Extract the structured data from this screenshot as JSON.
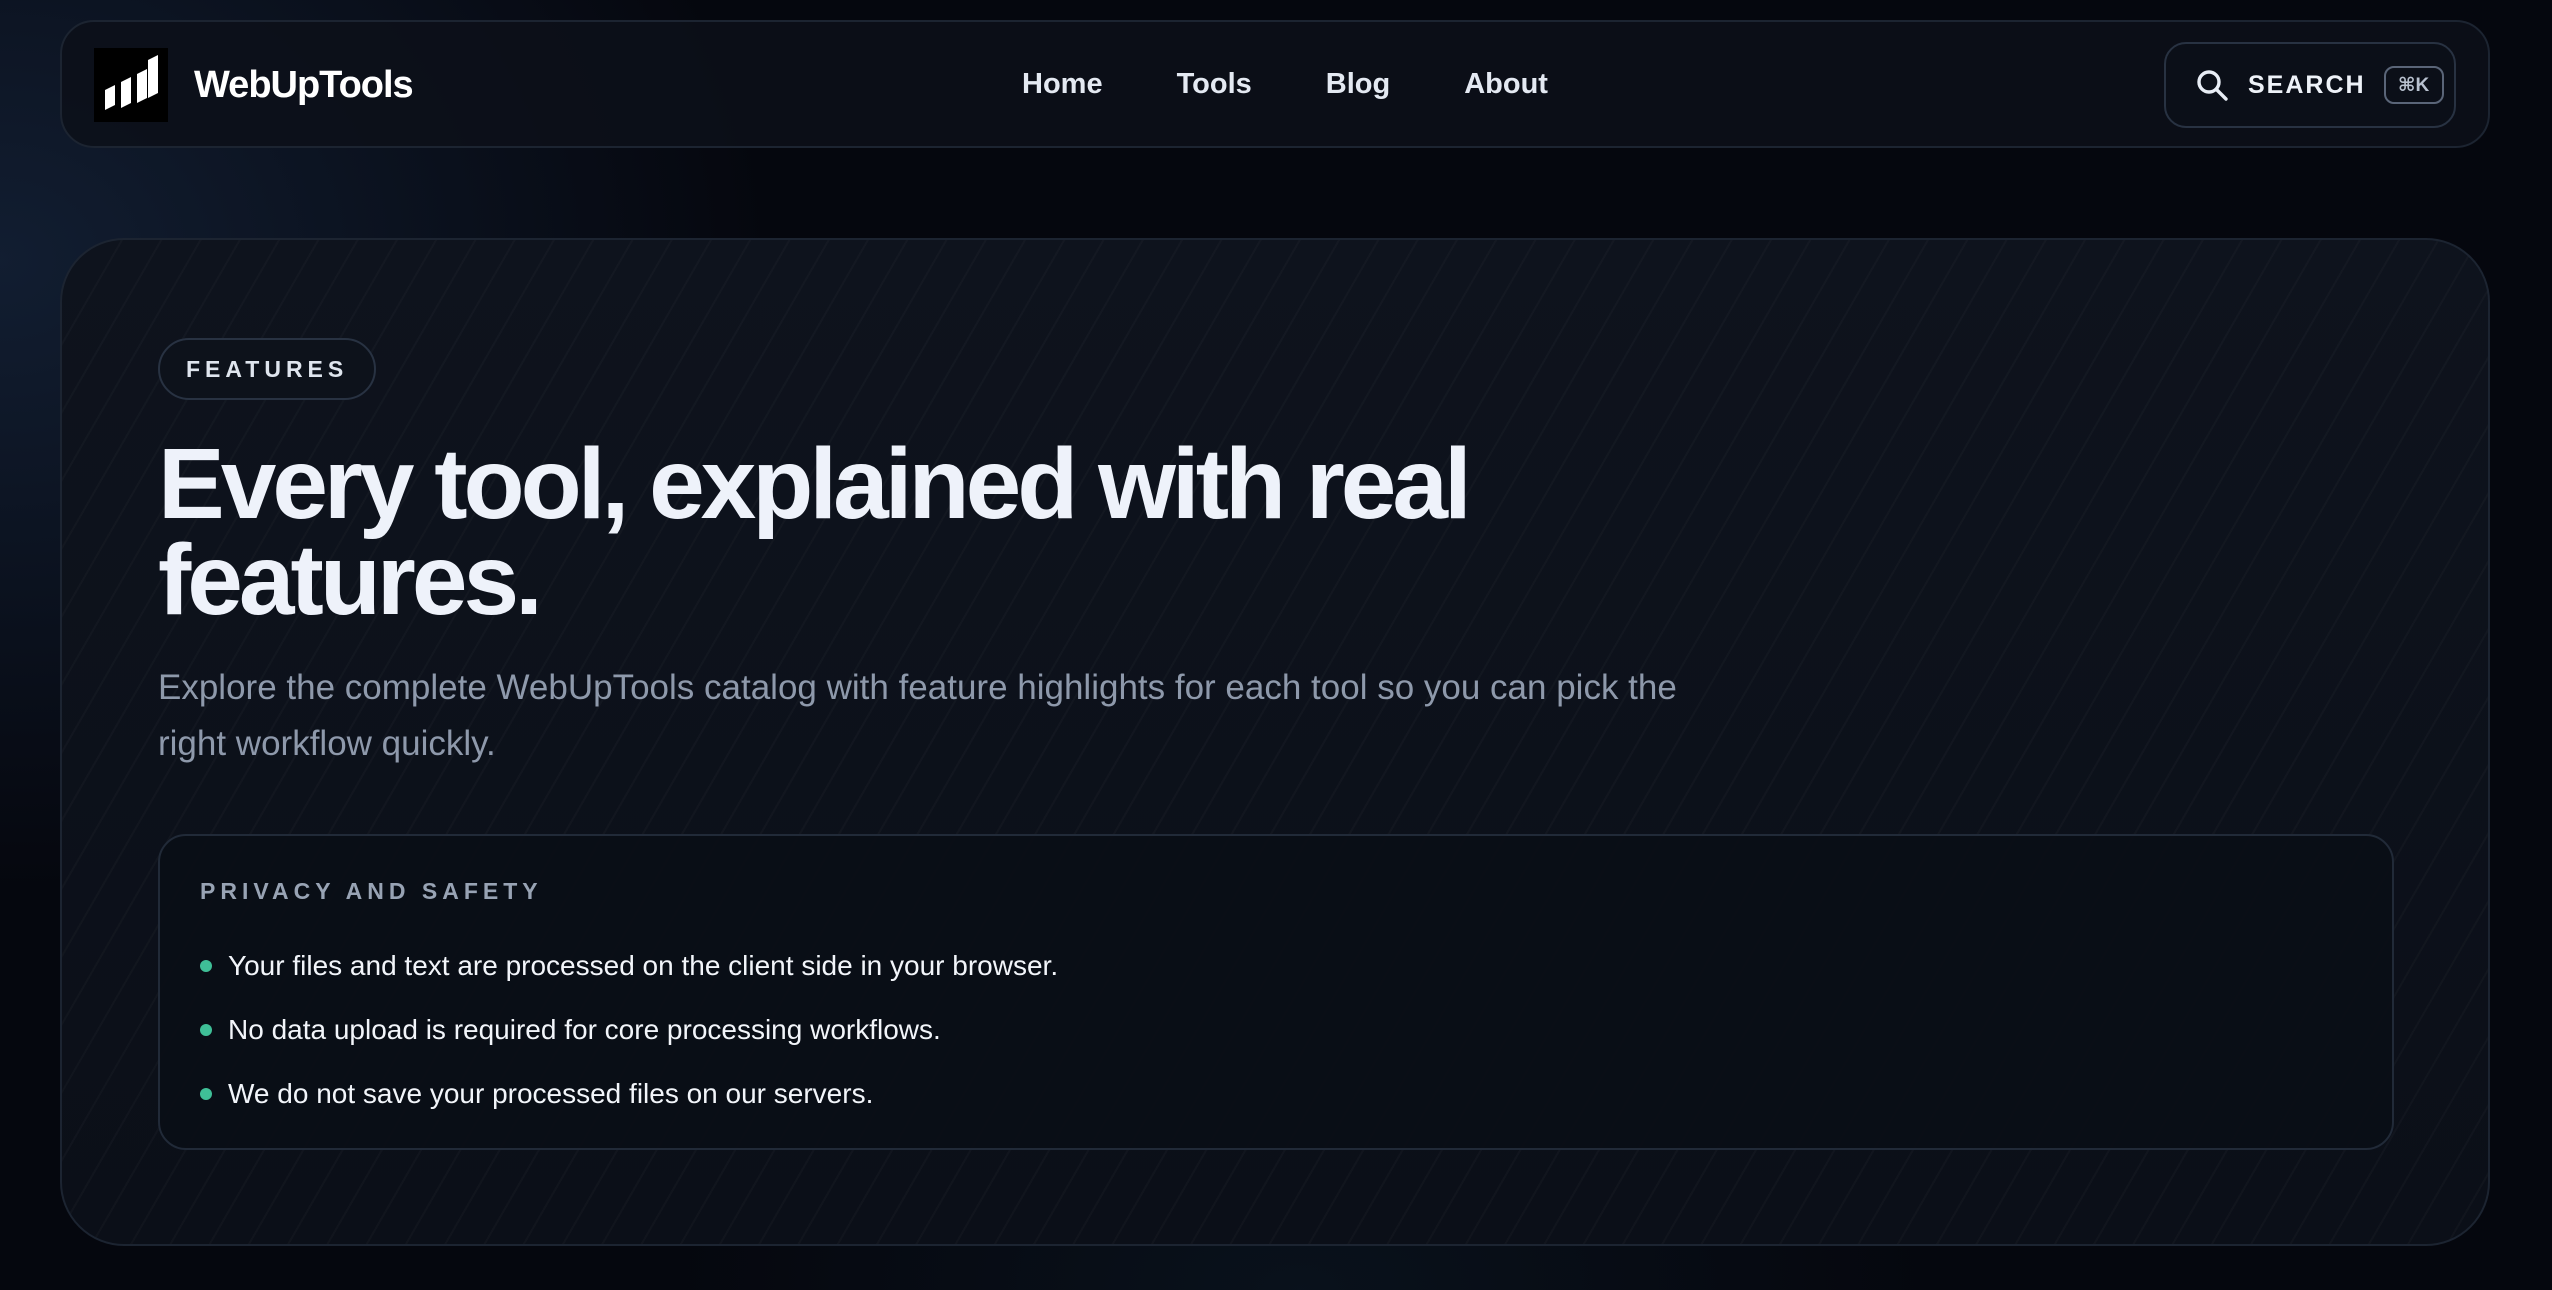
{
  "brand": {
    "name": "WebUpTools",
    "logo_icon": "webuptools-logo-icon"
  },
  "nav": {
    "links": [
      {
        "label": "Home"
      },
      {
        "label": "Tools"
      },
      {
        "label": "Blog"
      },
      {
        "label": "About"
      }
    ]
  },
  "search": {
    "label": "SEARCH",
    "shortcut": "⌘K",
    "icon": "search-icon"
  },
  "hero": {
    "badge": "FEATURES",
    "title": "Every tool, explained with real features.",
    "subtitle": "Explore the complete WebUpTools catalog with feature highlights for each tool so you can pick the right workflow quickly."
  },
  "privacy": {
    "heading": "PRIVACY AND SAFETY",
    "items": [
      "Your files and text are processed on the client side in your browser.",
      "No data upload is required for core processing workflows.",
      "We do not save your processed files on our servers."
    ]
  },
  "colors": {
    "background": "#05070e",
    "panel": "#0c111a",
    "accent_bullet": "#3fbf97",
    "text_primary": "#eef2fa",
    "text_muted": "#8e99ab"
  }
}
